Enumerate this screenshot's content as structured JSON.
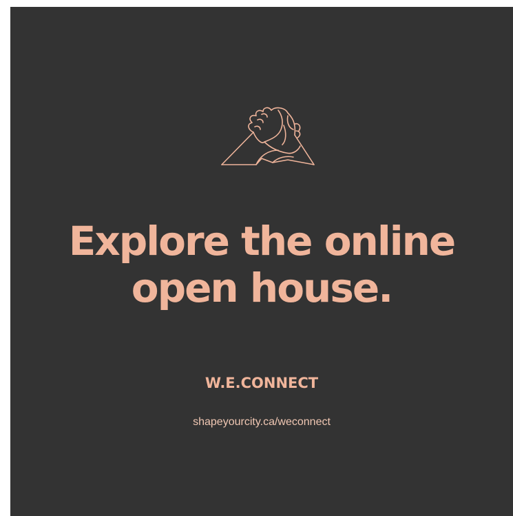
{
  "colors": {
    "background": "#333333",
    "accent": "#f0b59b"
  },
  "logo": {
    "icon": "clasped-hands-icon"
  },
  "headline": {
    "line1": "Explore the online",
    "line2": "open house."
  },
  "brand": {
    "name": "W.E.CONNECT"
  },
  "footer": {
    "url": "shapeyourcity.ca/weconnect"
  }
}
